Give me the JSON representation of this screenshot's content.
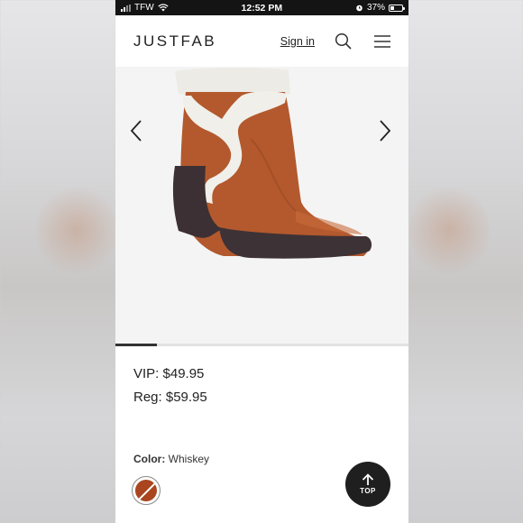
{
  "status_bar": {
    "carrier": "TFW",
    "time": "12:52 PM",
    "battery_percent": "37%",
    "battery_level": 0.37,
    "icons": [
      "signal-icon",
      "wifi-icon",
      "alarm-icon",
      "battery-icon"
    ]
  },
  "header": {
    "logo": "JUSTFAB",
    "sign_in": "Sign in",
    "icons": [
      "search-icon",
      "menu-icon"
    ]
  },
  "gallery": {
    "icons": [
      "chevron-left-icon",
      "chevron-right-icon"
    ],
    "progress_fraction": 0.14
  },
  "product": {
    "vip_price": "VIP: $49.95",
    "reg_price": "Reg: $59.95",
    "color_label": "Color:",
    "color_value": "Whiskey"
  },
  "colors": {
    "swatch": "#a9461f",
    "boot": "#b55a2e"
  },
  "top_button": {
    "label": "TOP",
    "icon": "arrow-up-icon"
  }
}
